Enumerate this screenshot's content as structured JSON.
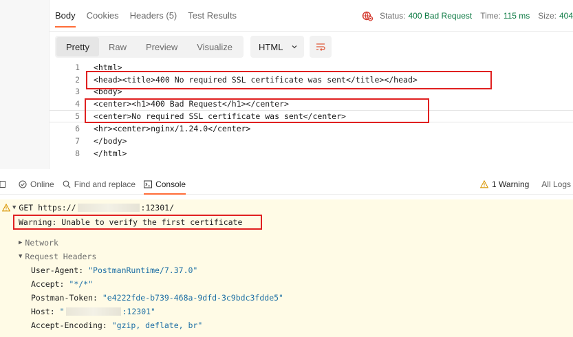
{
  "response_tabs": [
    {
      "label": "Body",
      "active": true
    },
    {
      "label": "Cookies",
      "active": false
    },
    {
      "label": "Headers (5)",
      "active": false
    },
    {
      "label": "Test Results",
      "active": false
    }
  ],
  "status": {
    "status_label": "Status:",
    "status_value": "400 Bad Request",
    "time_label": "Time:",
    "time_value": "115 ms",
    "size_label": "Size:",
    "size_value": "404"
  },
  "view_modes": [
    {
      "label": "Pretty",
      "active": true
    },
    {
      "label": "Raw",
      "active": false
    },
    {
      "label": "Preview",
      "active": false
    },
    {
      "label": "Visualize",
      "active": false
    }
  ],
  "format_select": {
    "value": "HTML"
  },
  "code_lines": [
    {
      "num": "1",
      "text": "<html>"
    },
    {
      "num": "2",
      "text": "<head><title>400 No required SSL certificate was sent</title></head>"
    },
    {
      "num": "3",
      "text": "<body>"
    },
    {
      "num": "4",
      "text": "<center><h1>400 Bad Request</h1></center>"
    },
    {
      "num": "5",
      "text": "<center>No required SSL certificate was sent</center>"
    },
    {
      "num": "6",
      "text": "<hr><center>nginx/1.24.0</center>"
    },
    {
      "num": "7",
      "text": "</body>"
    },
    {
      "num": "8",
      "text": "</html>"
    }
  ],
  "console_bar": {
    "online": "Online",
    "find_replace": "Find and replace",
    "console": "Console",
    "warnings": "1 Warning",
    "all_logs": "All Logs"
  },
  "console": {
    "request_method": "GET",
    "request_url_prefix": "https://",
    "request_url_suffix": ":12301/",
    "warning_text": "Warning: Unable to verify the first certificate",
    "network_label": "Network",
    "request_headers_label": "Request Headers",
    "headers": [
      {
        "key": "User-Agent:",
        "value": "\"PostmanRuntime/7.37.0\""
      },
      {
        "key": "Accept:",
        "value": "\"*/*\""
      },
      {
        "key": "Postman-Token:",
        "value": "\"e4222fde-b739-468a-9dfd-3c9bdc3fdde5\""
      },
      {
        "key": "Host:",
        "value_prefix": "\"",
        "value_suffix": ":12301\""
      },
      {
        "key": "Accept-Encoding:",
        "value": "\"gzip, deflate, br\""
      }
    ]
  },
  "colors": {
    "accent": "#ff6c37",
    "success": "#0c7a43",
    "highlight_box": "#e02020",
    "console_bg": "#fffbe6",
    "string": "#1c6ea4"
  }
}
